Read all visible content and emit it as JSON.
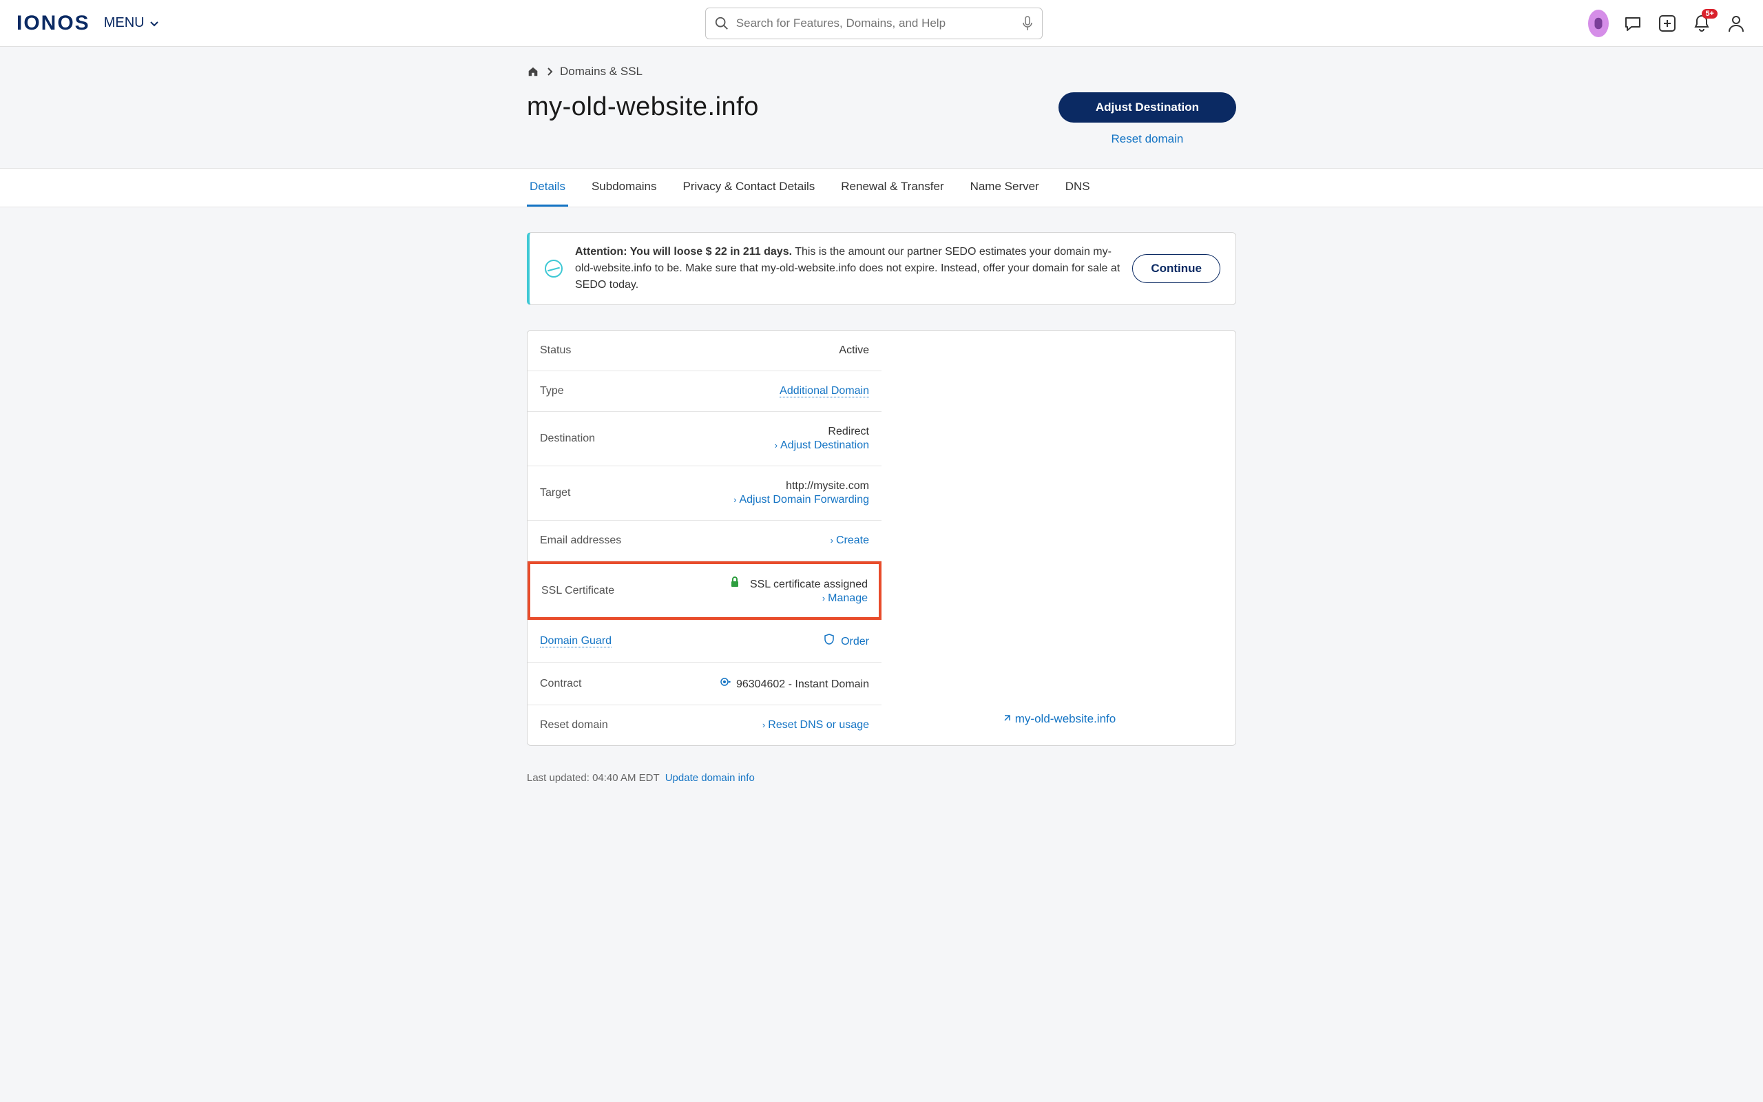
{
  "header": {
    "logo": "IONOS",
    "menu": "MENU",
    "search_placeholder": "Search for Features, Domains, and Help",
    "notif_badge": "5+"
  },
  "breadcrumb": {
    "section": "Domains & SSL"
  },
  "title": "my-old-website.info",
  "actions": {
    "adjust": "Adjust Destination",
    "reset": "Reset domain"
  },
  "tabs": [
    "Details",
    "Subdomains",
    "Privacy & Contact Details",
    "Renewal & Transfer",
    "Name Server",
    "DNS"
  ],
  "alert": {
    "bold": "Attention: You will loose $ 22 in 211 days.",
    "rest": " This is the amount our partner SEDO estimates your domain my-old-website.info to be. Make sure that my-old-website.info does not expire. Instead, offer your domain for sale at SEDO today.",
    "cta": "Continue"
  },
  "rows": {
    "status": {
      "label": "Status",
      "value": "Active"
    },
    "type": {
      "label": "Type",
      "value": "Additional Domain"
    },
    "dest": {
      "label": "Destination",
      "value": "Redirect",
      "link": "Adjust Destination"
    },
    "target": {
      "label": "Target",
      "value": "http://mysite.com",
      "link": "Adjust Domain Forwarding"
    },
    "email": {
      "label": "Email addresses",
      "link": "Create"
    },
    "ssl": {
      "label": "SSL Certificate",
      "value": "SSL certificate assigned",
      "link": "Manage"
    },
    "guard": {
      "label": "Domain Guard",
      "link": "Order"
    },
    "contract": {
      "label": "Contract",
      "value": "96304602 - Instant Domain"
    },
    "resetd": {
      "label": "Reset domain",
      "link": "Reset DNS or usage"
    }
  },
  "external": "my-old-website.info",
  "footer": {
    "updated": "Last updated: 04:40 AM EDT",
    "update_link": "Update domain info"
  }
}
